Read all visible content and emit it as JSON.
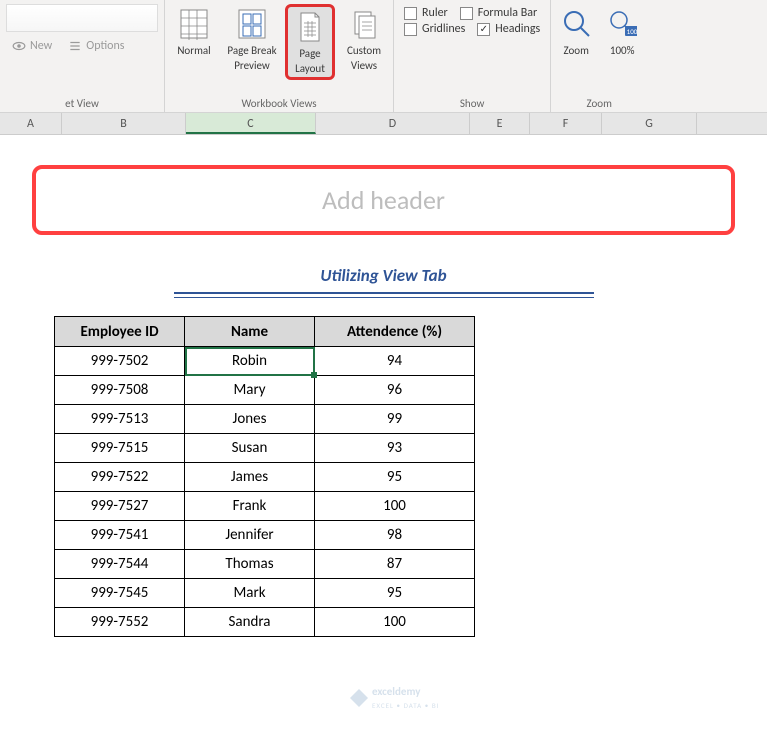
{
  "ribbon": {
    "sheetview": {
      "new": "New",
      "options": "Options",
      "group_label": "et View"
    },
    "views": {
      "normal": "Normal",
      "pagebreak": "Page Break Preview",
      "pagebreak_l1": "Page Break",
      "pagebreak_l2": "Preview",
      "pagelayout": "Page Layout",
      "pagelayout_l1": "Page",
      "pagelayout_l2": "Layout",
      "custom": "Custom Views",
      "custom_l1": "Custom",
      "custom_l2": "Views",
      "group_label": "Workbook Views"
    },
    "show": {
      "ruler": "Ruler",
      "gridlines": "Gridlines",
      "formula": "Formula Bar",
      "headings": "Headings",
      "group_label": "Show"
    },
    "zoom": {
      "zoom": "Zoom",
      "hundred": "100%",
      "group_label": "Zoom"
    }
  },
  "columns": [
    "A",
    "B",
    "C",
    "D",
    "E",
    "F",
    "G"
  ],
  "header_placeholder": "Add header",
  "sheet_title": "Utilizing View Tab",
  "table": {
    "headers": [
      "Employee ID",
      "Name",
      "Attendence (%)"
    ],
    "rows": [
      {
        "id": "999-7502",
        "name": "Robin",
        "att": "94"
      },
      {
        "id": "999-7508",
        "name": "Mary",
        "att": "96"
      },
      {
        "id": "999-7513",
        "name": "Jones",
        "att": "99"
      },
      {
        "id": "999-7515",
        "name": "Susan",
        "att": "93"
      },
      {
        "id": "999-7522",
        "name": "James",
        "att": "95"
      },
      {
        "id": "999-7527",
        "name": "Frank",
        "att": "100"
      },
      {
        "id": "999-7541",
        "name": "Jennifer",
        "att": "98"
      },
      {
        "id": "999-7544",
        "name": "Thomas",
        "att": "87"
      },
      {
        "id": "999-7545",
        "name": "Mark",
        "att": "95"
      },
      {
        "id": "999-7552",
        "name": "Sandra",
        "att": "100"
      }
    ]
  },
  "watermark": {
    "brand": "exceldemy",
    "tag": "EXCEL • DATA • BI"
  }
}
